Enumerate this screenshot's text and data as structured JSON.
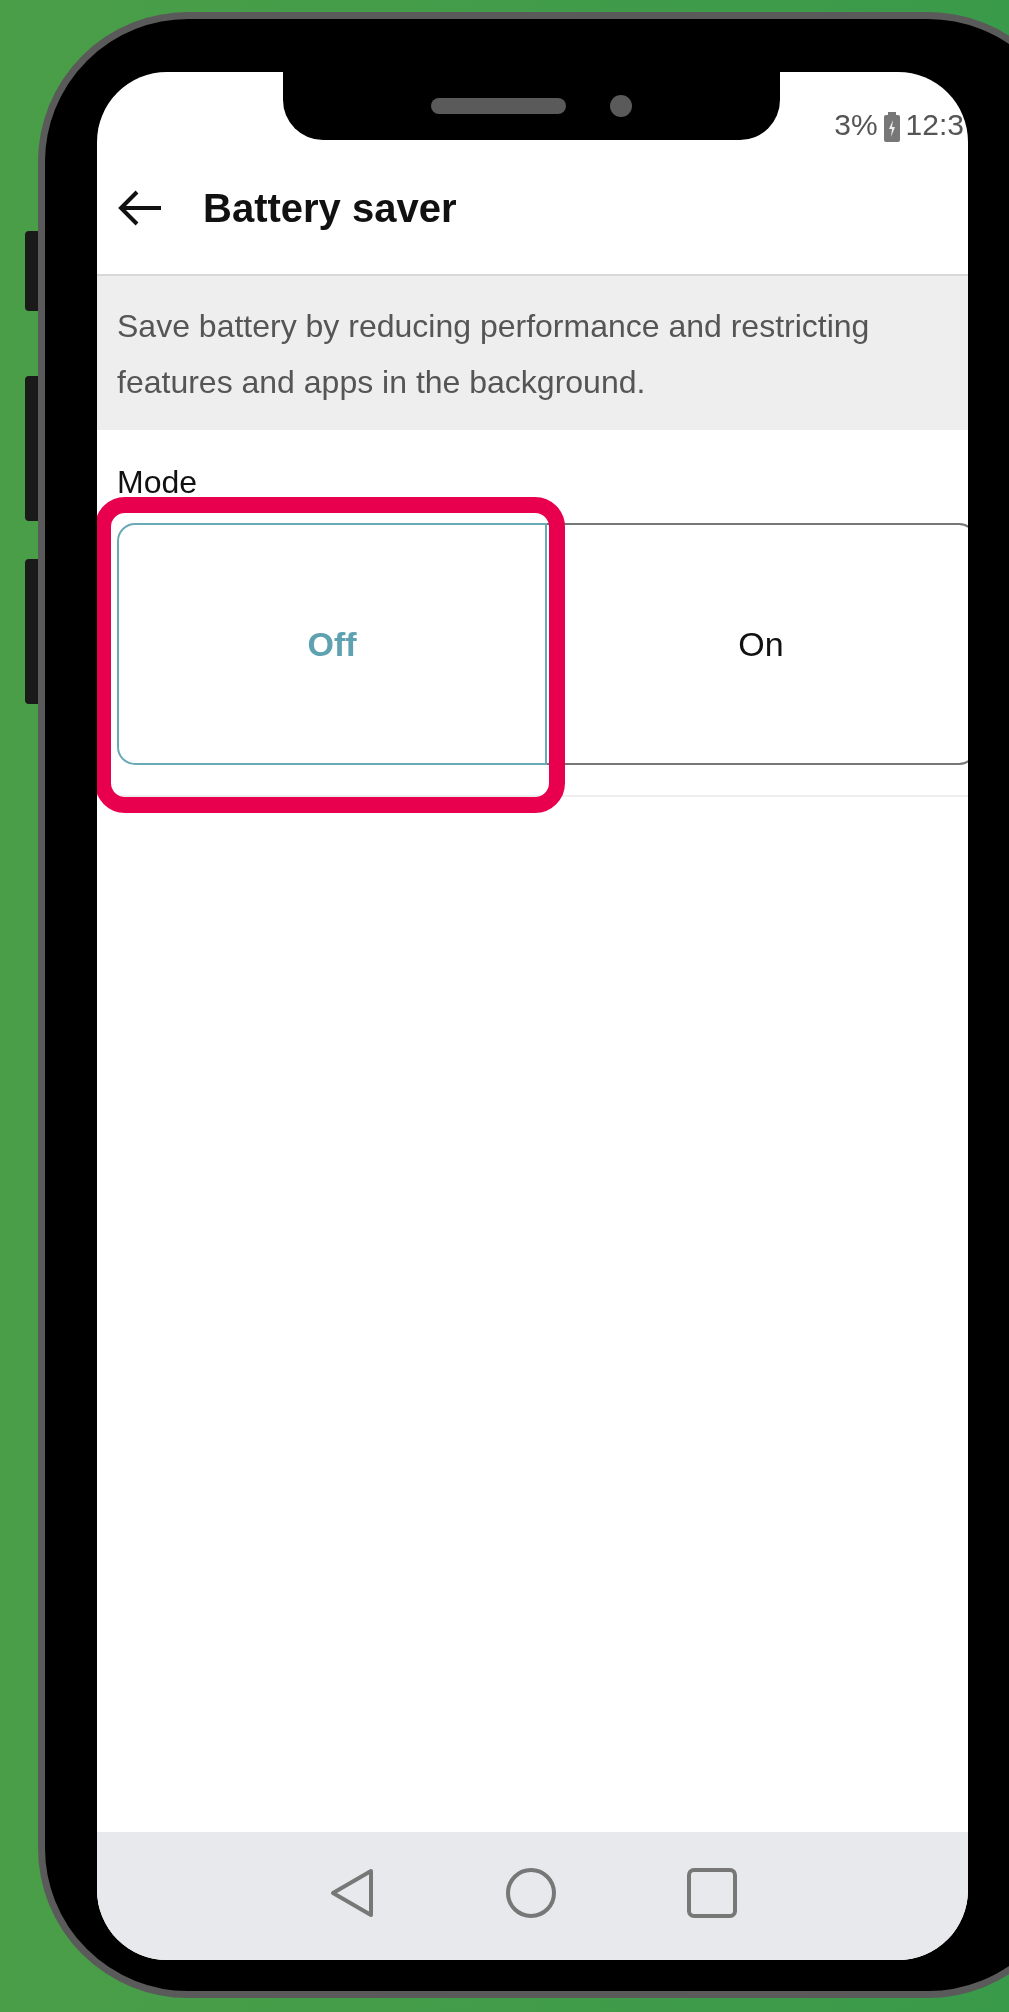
{
  "status_bar": {
    "battery": "3%",
    "time": "12:3"
  },
  "header": {
    "title": "Battery saver"
  },
  "description": "Save battery by reducing performance and restricting features and apps in the background.",
  "mode": {
    "label": "Mode",
    "options": [
      {
        "label": "Off",
        "selected": true
      },
      {
        "label": "On",
        "selected": false
      }
    ]
  }
}
